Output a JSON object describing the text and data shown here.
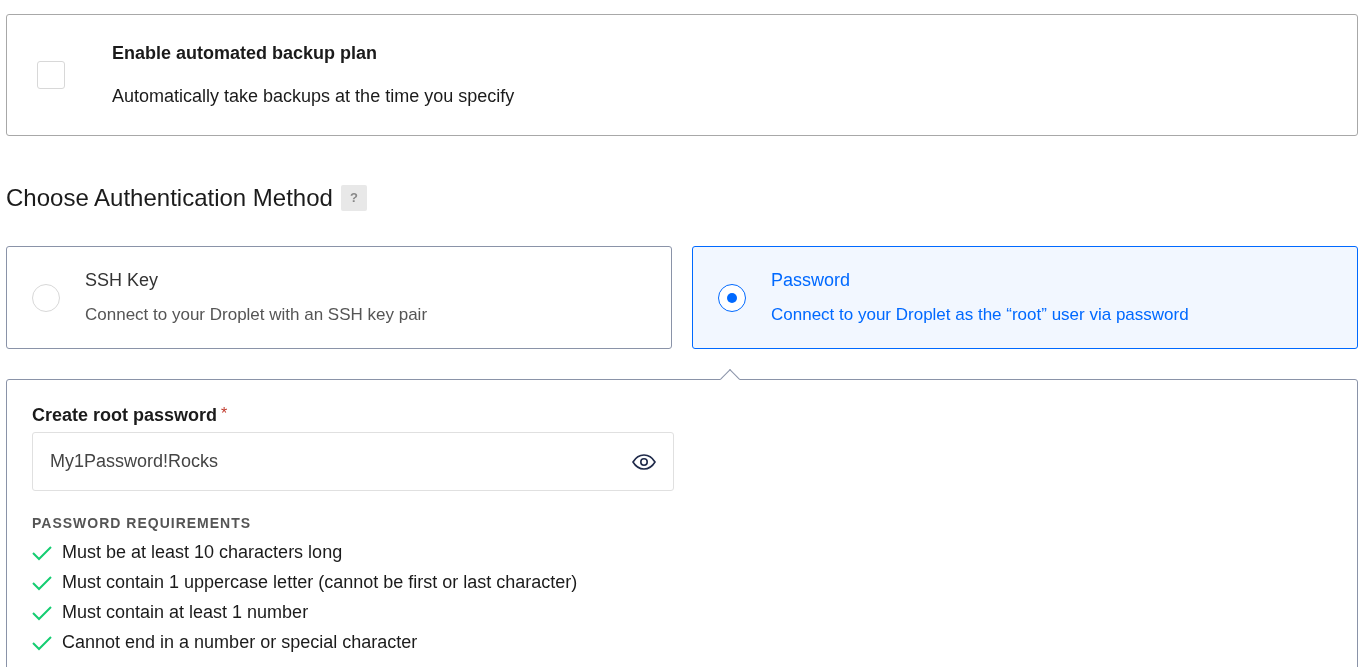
{
  "backup": {
    "checked": false,
    "title": "Enable automated backup plan",
    "description": "Automatically take backups at the time you specify"
  },
  "auth": {
    "heading": "Choose Authentication Method",
    "help": "?",
    "options": [
      {
        "title": "SSH Key",
        "description": "Connect to your Droplet with an SSH key pair",
        "selected": false
      },
      {
        "title": "Password",
        "description": "Connect to your Droplet as the “root” user via password",
        "selected": true
      }
    ]
  },
  "password": {
    "label": "Create root password",
    "required_mark": "*",
    "value": "My1Password!Rocks",
    "requirements_heading": "PASSWORD REQUIREMENTS",
    "requirements": [
      {
        "text": "Must be at least 10 characters long",
        "met": true
      },
      {
        "text": "Must contain 1 uppercase letter (cannot be first or last character)",
        "met": true
      },
      {
        "text": "Must contain at least 1 number",
        "met": true
      },
      {
        "text": "Cannot end in a number or special character",
        "met": true
      }
    ]
  }
}
